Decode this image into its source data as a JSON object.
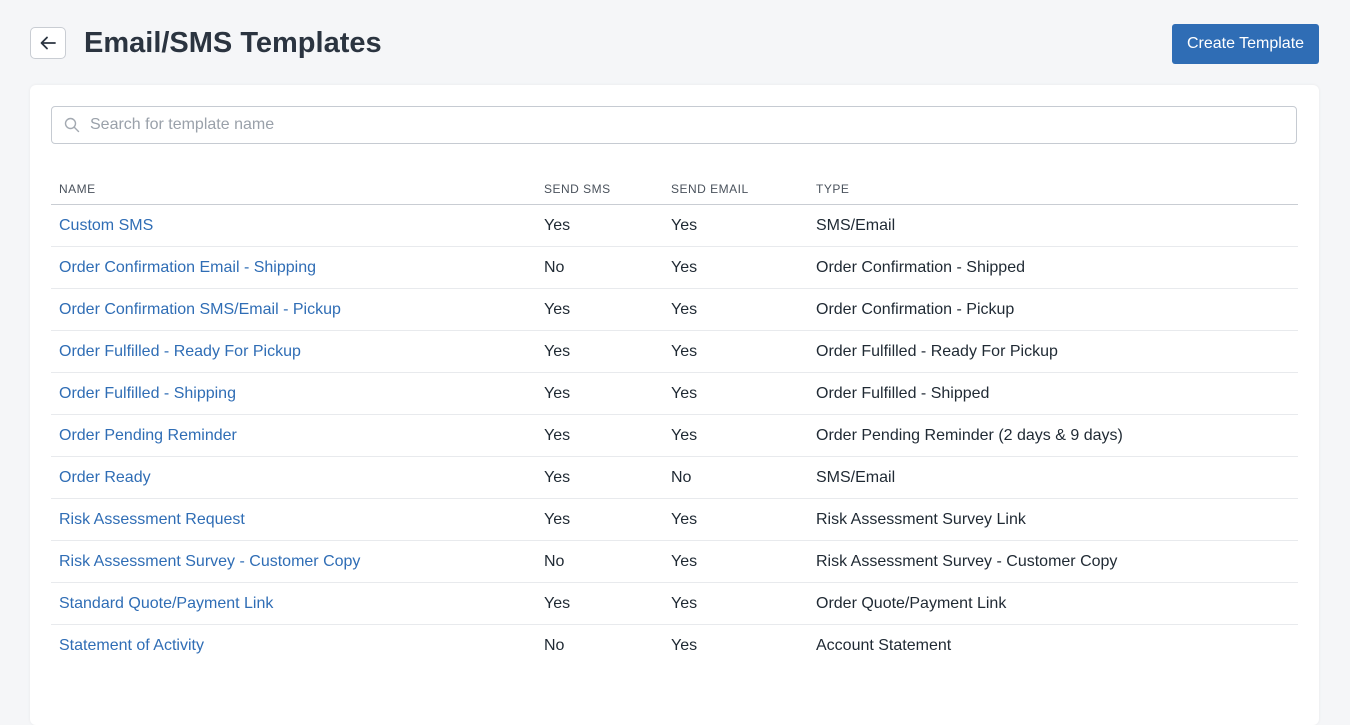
{
  "header": {
    "title": "Email/SMS Templates",
    "back_icon": "arrow-left-icon",
    "create_label": "Create Template"
  },
  "colors": {
    "accent": "#2f6db5",
    "background": "#f5f6f8"
  },
  "search": {
    "placeholder": "Search for template name",
    "value": "",
    "icon": "search-icon"
  },
  "table": {
    "columns": [
      "NAME",
      "SEND SMS",
      "SEND EMAIL",
      "TYPE"
    ],
    "rows": [
      {
        "name": "Custom SMS",
        "sms": "Yes",
        "email": "Yes",
        "type": "SMS/Email"
      },
      {
        "name": "Order Confirmation Email - Shipping",
        "sms": "No",
        "email": "Yes",
        "type": "Order Confirmation - Shipped"
      },
      {
        "name": "Order Confirmation SMS/Email - Pickup",
        "sms": "Yes",
        "email": "Yes",
        "type": "Order Confirmation - Pickup"
      },
      {
        "name": "Order Fulfilled - Ready For Pickup",
        "sms": "Yes",
        "email": "Yes",
        "type": "Order Fulfilled - Ready For Pickup"
      },
      {
        "name": "Order Fulfilled - Shipping",
        "sms": "Yes",
        "email": "Yes",
        "type": "Order Fulfilled - Shipped"
      },
      {
        "name": "Order Pending Reminder",
        "sms": "Yes",
        "email": "Yes",
        "type": "Order Pending Reminder (2 days & 9 days)"
      },
      {
        "name": "Order Ready",
        "sms": "Yes",
        "email": "No",
        "type": "SMS/Email"
      },
      {
        "name": "Risk Assessment Request",
        "sms": "Yes",
        "email": "Yes",
        "type": "Risk Assessment Survey Link"
      },
      {
        "name": "Risk Assessment Survey - Customer Copy",
        "sms": "No",
        "email": "Yes",
        "type": "Risk Assessment Survey - Customer Copy"
      },
      {
        "name": "Standard Quote/Payment Link",
        "sms": "Yes",
        "email": "Yes",
        "type": "Order Quote/Payment Link"
      },
      {
        "name": "Statement of Activity",
        "sms": "No",
        "email": "Yes",
        "type": "Account Statement"
      }
    ]
  }
}
